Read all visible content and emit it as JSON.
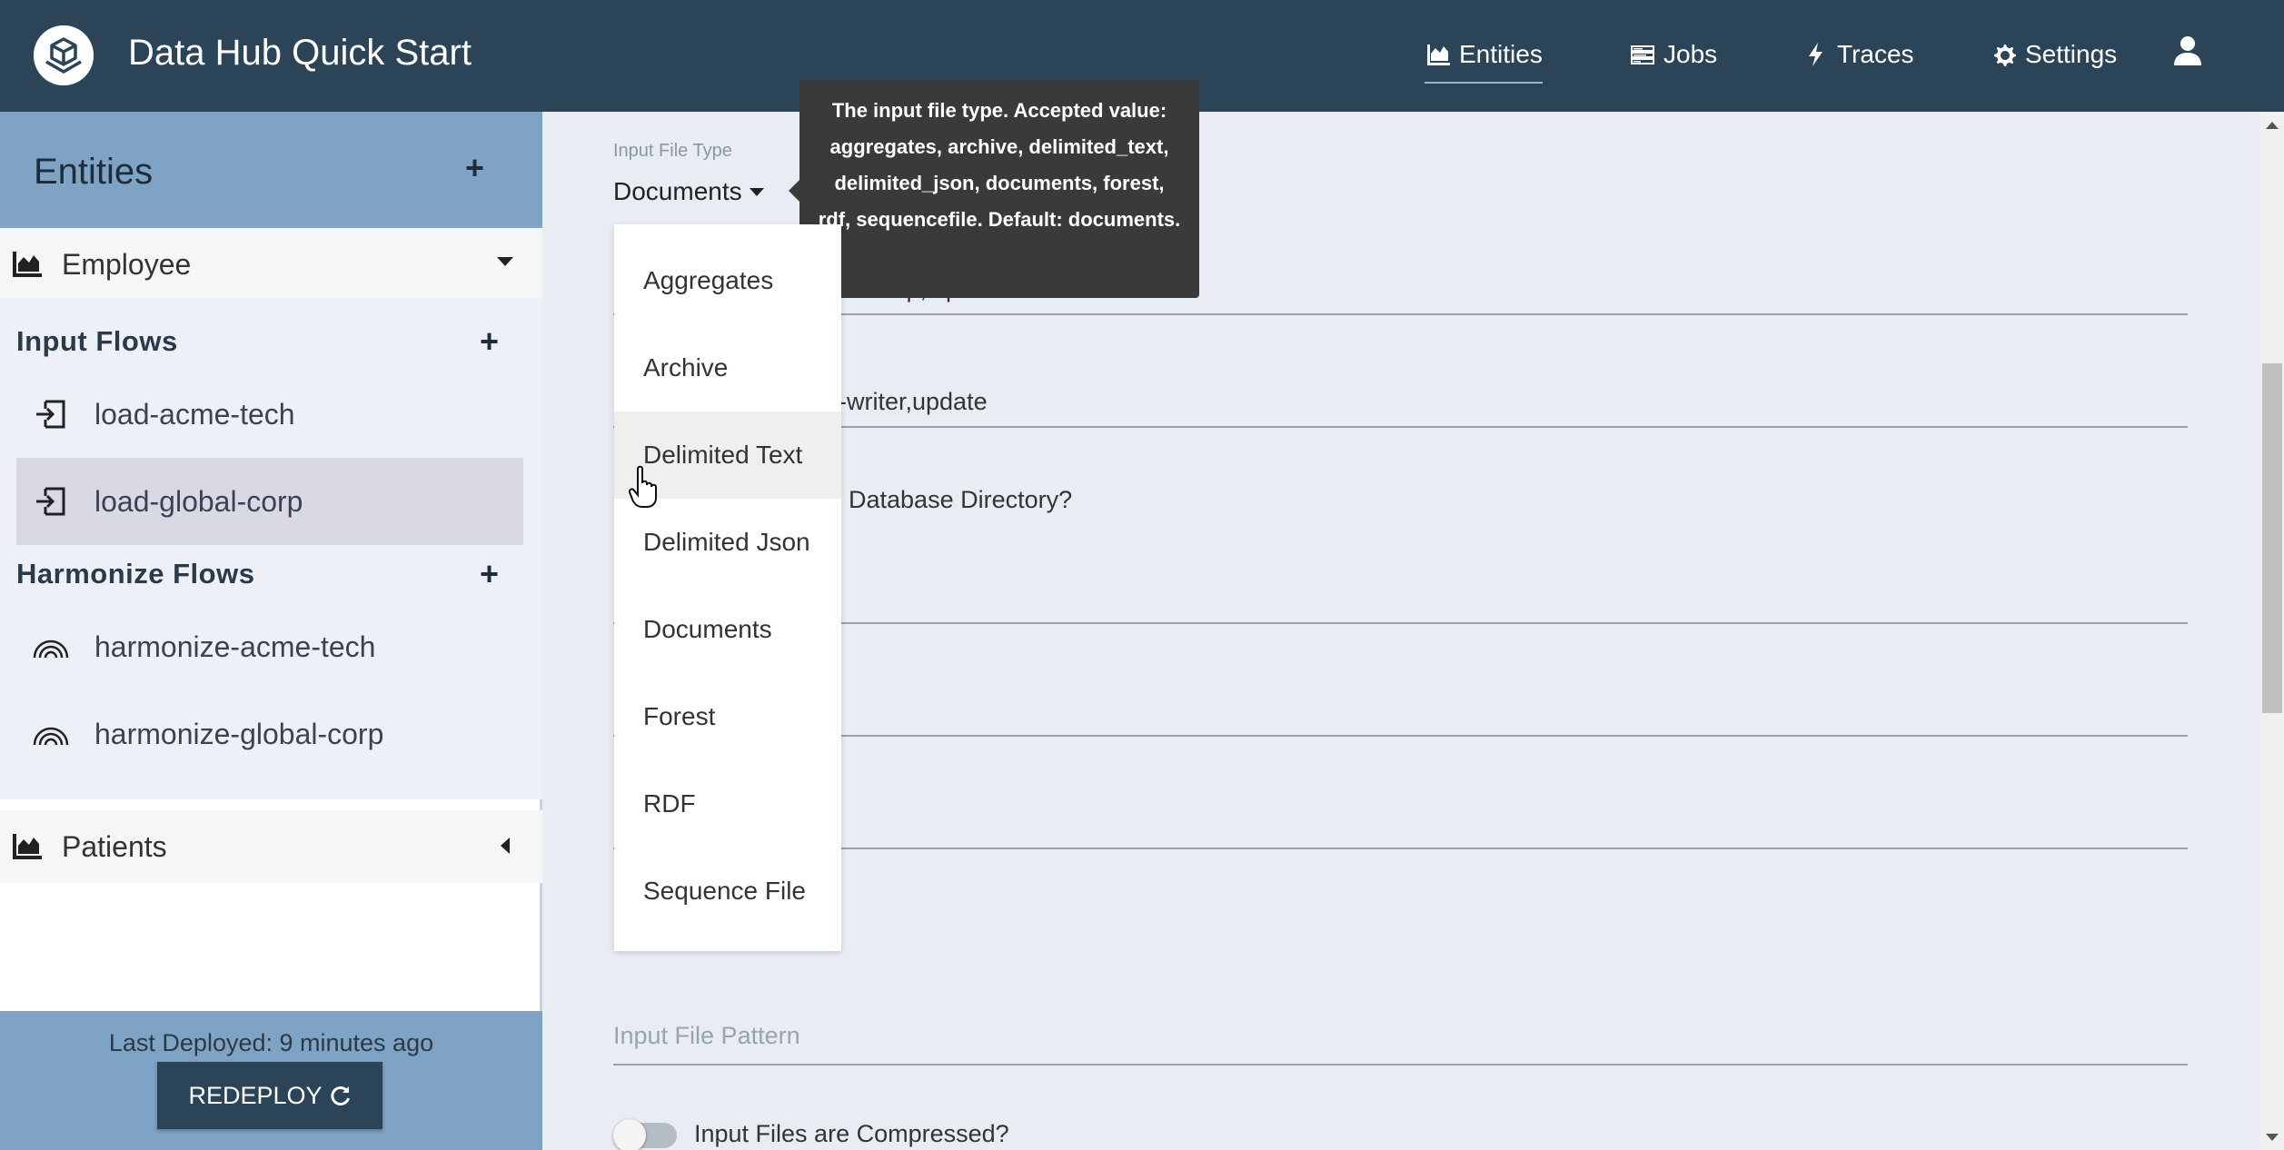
{
  "header": {
    "app_title": "Data Hub Quick Start",
    "nav": [
      {
        "label": "Entities",
        "icon": "chart-area-icon",
        "active": true
      },
      {
        "label": "Jobs",
        "icon": "tasks-icon"
      },
      {
        "label": "Traces",
        "icon": "bolt-icon"
      },
      {
        "label": "Settings",
        "icon": "gear-icon"
      }
    ]
  },
  "sidebar": {
    "title": "Entities",
    "entities": [
      {
        "name": "Employee",
        "expanded": true,
        "input_flows_label": "Input Flows",
        "input_flows": [
          "load-acme-tech",
          "load-global-corp"
        ],
        "harmonize_flows_label": "Harmonize Flows",
        "harmonize_flows": [
          "harmonize-acme-tech",
          "harmonize-global-corp"
        ]
      },
      {
        "name": "Patients",
        "expanded": false
      }
    ],
    "last_deployed": "Last Deployed: 9 minutes ago",
    "redeploy_label": "REDEPLOY"
  },
  "form": {
    "input_file_type_label": "Input File Type",
    "input_file_type_value": "Documents",
    "collections_partial": "al-corp,input",
    "permissions_partial": "st-writer,update",
    "db_directory_partial": "Database Directory?",
    "input_file_pattern_placeholder": "Input File Pattern",
    "compressed_label": "Input Files are Compressed?"
  },
  "dropdown": {
    "options": [
      "Aggregates",
      "Archive",
      "Delimited Text",
      "Delimited Json",
      "Documents",
      "Forest",
      "RDF",
      "Sequence File"
    ],
    "hovered": "Delimited Text"
  },
  "tooltip": {
    "text": "The input file type. Accepted value: aggregates, archive, delimited_text, delimited_json, documents, forest, rdf, sequencefile. Default: documents."
  },
  "colors": {
    "header_bg": "#2b4458",
    "sidebar_accent": "#7fa3c4",
    "selected_flow": "#d9d9e6"
  }
}
